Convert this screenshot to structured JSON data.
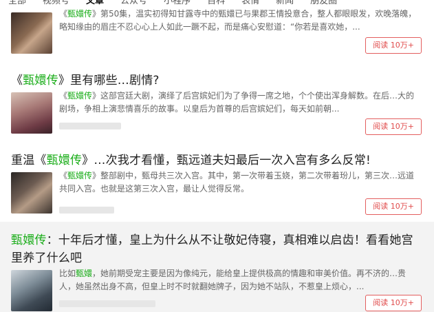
{
  "tabs": [
    "全部",
    "视频号",
    "文章",
    "公众号",
    "小程序",
    "百科",
    "表情",
    "新闻",
    "朋友圈"
  ],
  "active_tab": "文章",
  "results": [
    {
      "title_parts": [],
      "snippet_hl": "甄嬛传",
      "snippet_pre": "《",
      "snippet": "》第50集，温实初得知甘露寺中的甄嬛已与果郡王情投意合，整人都眼眼发，欢晚落魄，略知缘由的眉庄不忍心心上人如此一蹶不起，而是痛心安慰道：“你若是喜欢她，...",
      "read_label": "阅读 10万+"
    },
    {
      "title_pre": "《",
      "title_hl": "甄嬛传",
      "title_post": "》里有哪些…剧情?",
      "snippet_pre": "《",
      "snippet_hl": "甄嬛传",
      "snippet": "》这部宫廷大剧，演绎了后宫嫔妃们为了争得一席之地，个个使出浑身解数。在后…大的剧场，争相上演悲情喜乐的故事。以皇后为首尊的后宫嫔妃们，每天如前朝...",
      "read_label": "阅读 10万+"
    },
    {
      "title_pre": "重温《",
      "title_hl": "甄嬛传",
      "title_post": "》…次我才看懂，甄远道夫妇最后一次入宫有多么反常!",
      "snippet_pre": "《",
      "snippet_hl": "甄嬛传",
      "snippet": "》整部剧中，甄母共三次入宫。其中，第一次带着玉娆，第二次带着玢儿，第三次…远道共同入宫。也就是这第三次入宫，最让人觉得反常。",
      "read_label": "阅读 10万+"
    },
    {
      "title_pre": "",
      "title_hl": "甄嬛传",
      "title_post": "：十年后才懂，皇上为什么从不让敬妃侍寝，真相难以启齿！看看她宫里养了什么吧",
      "snippet_pre": "比如",
      "snippet_hl": "甄嬛",
      "snippet": "，她前期受宠主要是因为像纯元，能给皇上提供极高的情趣和审美价值。再不济的…贵人，她虽然出身不高，但皇上时不时就翻她牌子，因为她不站队，不惹皇上烦心，...",
      "read_label": "阅读 10万+"
    }
  ]
}
